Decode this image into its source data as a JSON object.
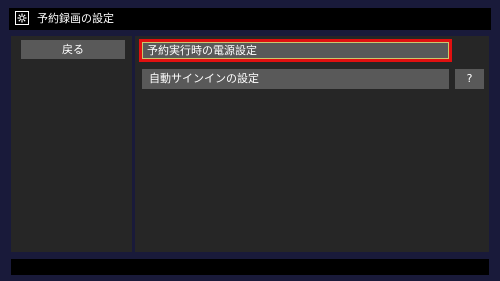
{
  "window": {
    "title": "予約録画の設定",
    "icon": "gear-icon"
  },
  "left_pane": {
    "back_label": "戻る"
  },
  "menu": {
    "items": [
      {
        "label": "予約実行時の電源設定",
        "selected": true
      },
      {
        "label": "自動サインインの設定",
        "selected": false
      }
    ],
    "help_label": "?"
  },
  "colors": {
    "background": "#191a3a",
    "pane": "#262626",
    "button": "#595959",
    "selection_border": "#e01010"
  }
}
